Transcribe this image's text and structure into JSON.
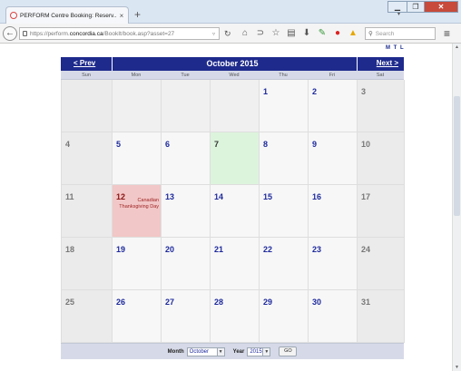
{
  "browser": {
    "tab_title": "PERFORM Centre Booking: Reserv...",
    "tab_close": "×",
    "new_tab": "+",
    "url_prefix": "https://perform.",
    "url_host": "concordia.ca",
    "url_path": "/BookIt/book.asp?asset=27",
    "search_placeholder": "Search",
    "icons": [
      "back-icon",
      "lock-icon",
      "reload-icon",
      "home-icon",
      "rss-icon",
      "star-icon",
      "reading-list-icon",
      "download-icon",
      "addon-icon",
      "stop-icon",
      "warning-icon",
      "menu-icon"
    ]
  },
  "page": {
    "mtl_logo": "M T L"
  },
  "calendar": {
    "prev_label": "< Prev",
    "next_label": "Next >",
    "month_title": "October 2015",
    "weekdays": [
      "Sun",
      "Mon",
      "Tue",
      "Wed",
      "Thu",
      "Fri",
      "Sat"
    ],
    "weeks": [
      [
        "",
        "",
        "",
        "",
        "1",
        "2",
        "3"
      ],
      [
        "4",
        "5",
        "6",
        "7",
        "8",
        "9",
        "10"
      ],
      [
        "11",
        "12",
        "13",
        "14",
        "15",
        "16",
        "17"
      ],
      [
        "18",
        "19",
        "20",
        "21",
        "22",
        "23",
        "24"
      ],
      [
        "25",
        "26",
        "27",
        "28",
        "29",
        "30",
        "31"
      ]
    ],
    "today": "7",
    "holiday": {
      "day": "12",
      "name": "Canadian Thanksgiving Day"
    },
    "footer": {
      "month_label": "Month",
      "month_value": "October",
      "year_label": "Year",
      "year_value": "2015",
      "go_label": "GO"
    },
    "colors": {
      "header": "#1e2a8c",
      "today": "#dcf4dc",
      "holiday": "#f2c7c7",
      "day_number": "#1e2a9c"
    }
  }
}
